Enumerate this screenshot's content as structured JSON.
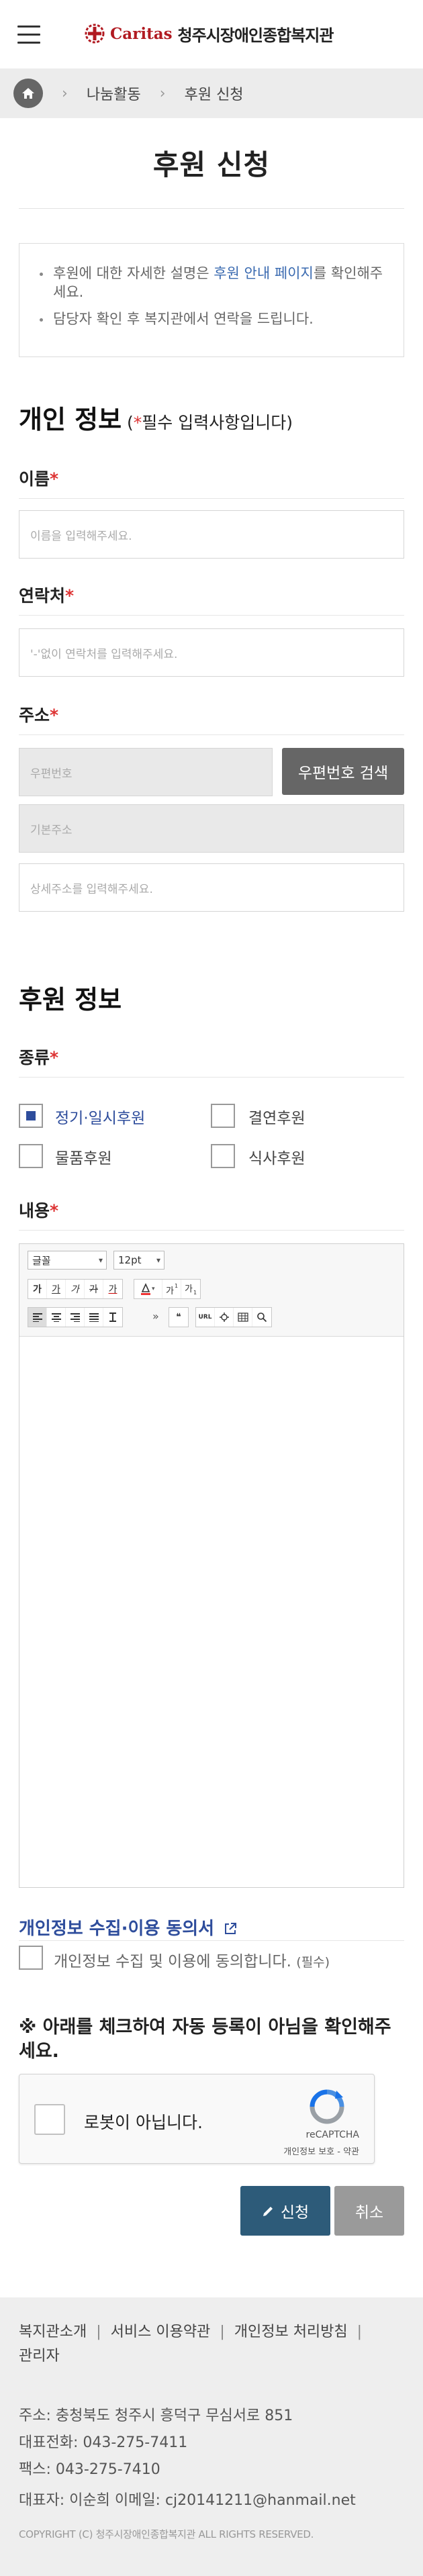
{
  "header": {
    "logo_brand": "Caritas",
    "logo_name": "청주시장애인종합복지관"
  },
  "breadcrumb": {
    "level1": "나눔활동",
    "level2": "후원 신청"
  },
  "page_title": "후원 신청",
  "notice": {
    "line1_pre": "후원에 대한 자세한 설명은 ",
    "line1_link": "후원 안내 페이지",
    "line1_post": "를 확인해주세요.",
    "line2": "담당자 확인 후 복지관에서 연락을 드립니다."
  },
  "personal": {
    "title": "개인 정보",
    "note_open": " (",
    "note_star": "*",
    "note_text": "필수 입력사항입니다)",
    "name_label": "이름",
    "name_placeholder": "이름을 입력해주세요.",
    "phone_label": "연락처",
    "phone_placeholder": "'-'없이 연락처를 입력해주세요.",
    "address_label": "주소",
    "zip_placeholder": "우편번호",
    "zip_button": "우편번호 검색",
    "address1_placeholder": "기본주소",
    "address2_placeholder": "상세주소를 입력해주세요.",
    "required_star": "*"
  },
  "donation": {
    "title": "후원 정보",
    "type_label": "종류",
    "types": [
      {
        "label": "정기·일시후원",
        "checked": true
      },
      {
        "label": "결연후원",
        "checked": false
      },
      {
        "label": "물품후원",
        "checked": false
      },
      {
        "label": "식사후원",
        "checked": false
      }
    ],
    "content_label": "내용",
    "editor": {
      "font_select": "글꼴",
      "size_select": "12pt",
      "row2_buttons": [
        "가",
        "가",
        "가",
        "가",
        "가"
      ],
      "row3_more": "»",
      "quote": "❝",
      "url": "URL"
    }
  },
  "agreement": {
    "title": "개인정보 수집·이용 동의서",
    "label": "개인정보 수집 및 이용에 동의합니다.",
    "required": "(필수)"
  },
  "captcha": {
    "note": "※ 아래를 체크하여 자동 등록이 아님을 확인해주세요.",
    "label": "로봇이 아닙니다.",
    "brand": "reCAPTCHA",
    "terms": "개인정보 보호 - 약관"
  },
  "actions": {
    "submit": "신청",
    "cancel": "취소"
  },
  "footer": {
    "links": [
      "복지관소개",
      "서비스 이용약관",
      "개인정보 처리방침",
      "관리자"
    ],
    "address": "주소: 충청북도 청주시 흥덕구 무심서로 851",
    "tel": "대표전화: 043-275-7411",
    "fax": "팩스: 043-275-7410",
    "rep": "대표자: 이순희   이메일: cj20141211@hanmail.net",
    "copyright": "COPYRIGHT (C) 청주시장애인종합복지관 ALL RIGHTS RESERVED."
  },
  "colors": {
    "accent": "#2e4d9c",
    "brand": "#b11a21",
    "submit": "#2d5b79",
    "required": "#dd3333"
  }
}
